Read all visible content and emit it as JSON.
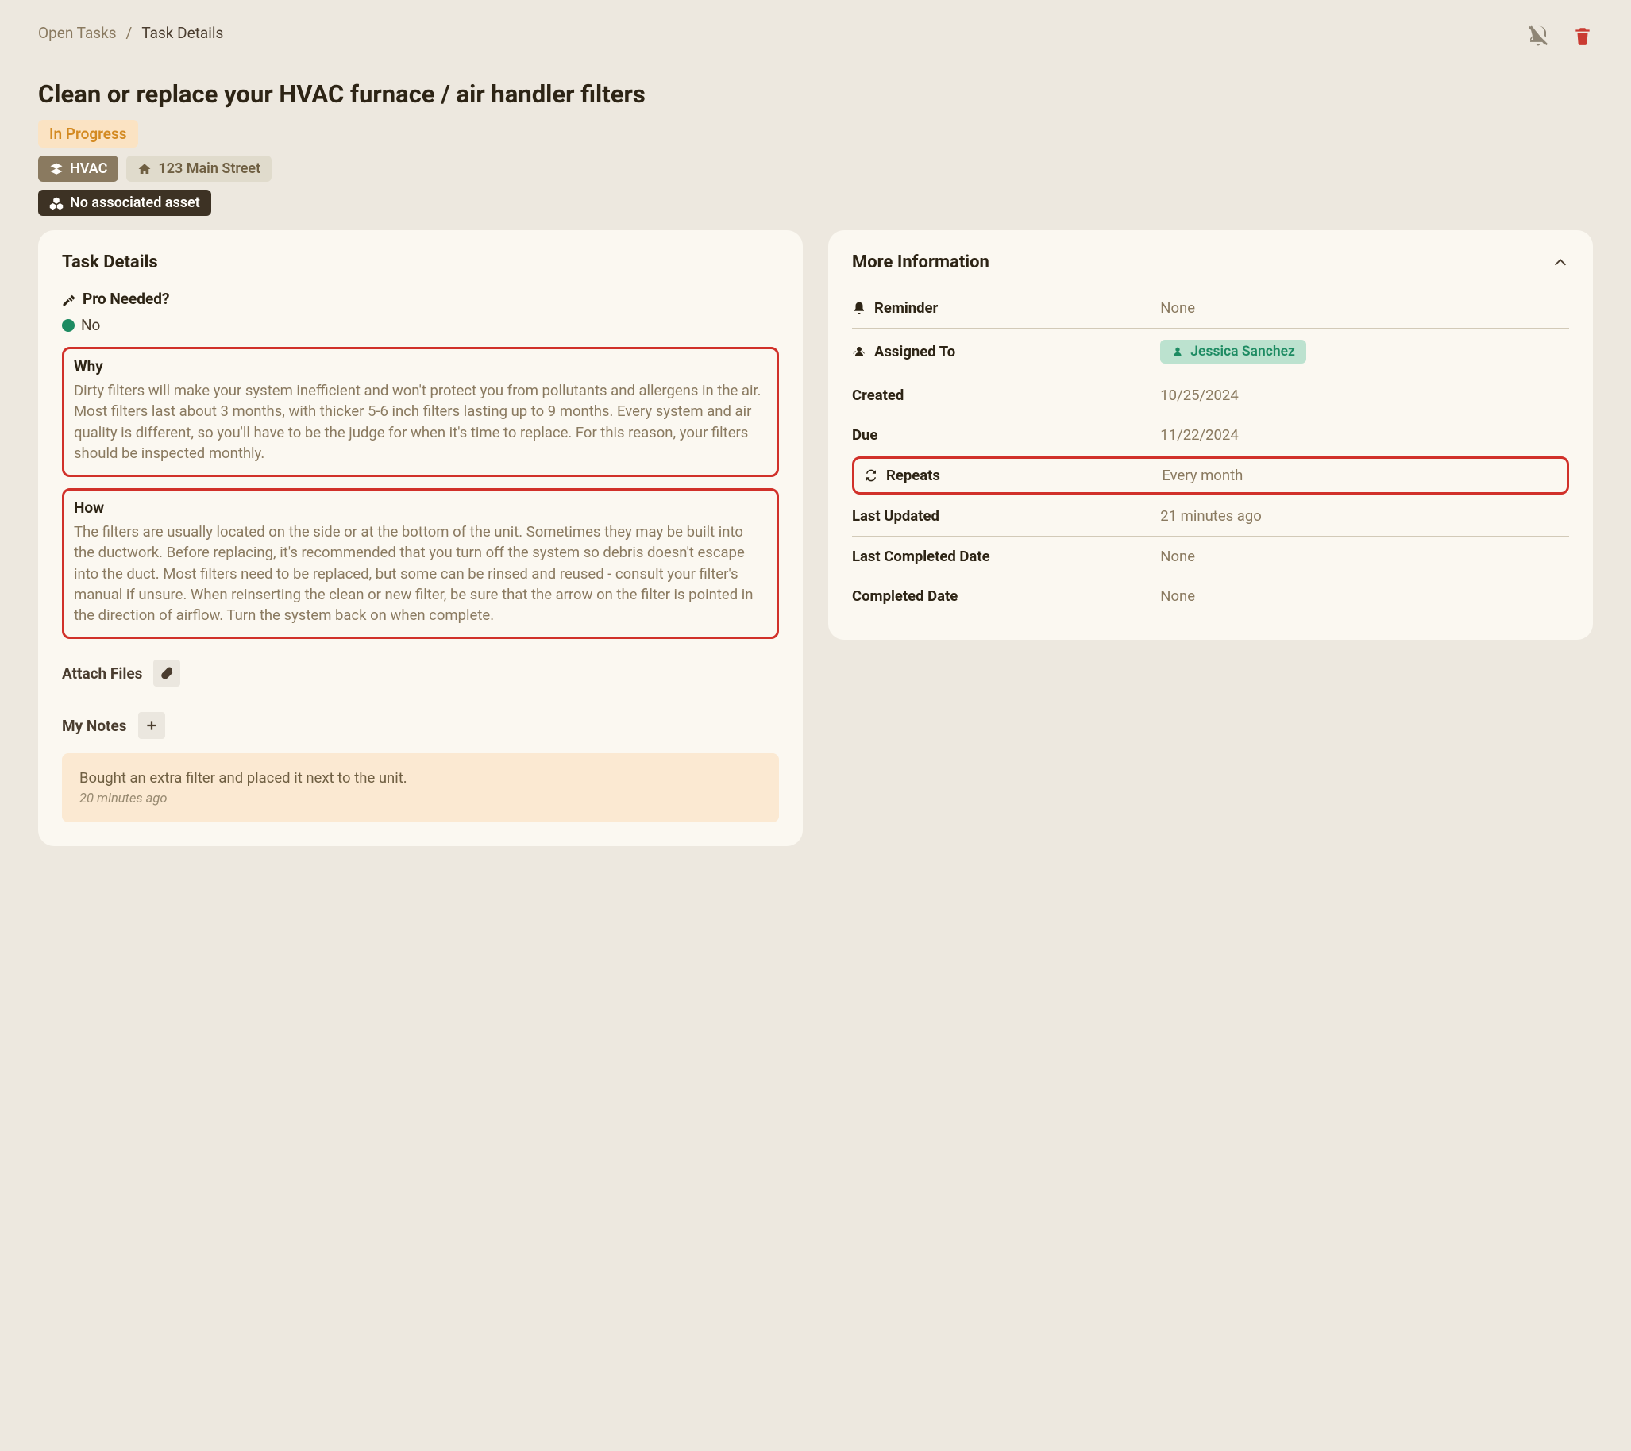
{
  "breadcrumb": {
    "root": "Open Tasks",
    "separator": "/",
    "current": "Task Details"
  },
  "title": "Clean or replace your HVAC furnace / air handler filters",
  "status_badge": "In Progress",
  "category_badge": "HVAC",
  "address_badge": "123 Main Street",
  "asset_badge": "No associated asset",
  "left_card": {
    "heading": "Task Details",
    "pro_heading": "Pro Needed?",
    "pro_answer": "No",
    "why_title": "Why",
    "why_body": "Dirty filters will make your system inefficient and won't protect you from pollutants and allergens in the air. Most filters last about 3 months, with thicker 5-6 inch filters lasting up to 9 months. Every system and air quality is different, so you'll have to be the judge for when it's time to replace. For this reason, your filters should be inspected monthly.",
    "how_title": "How",
    "how_body": "The filters are usually located on the side or at the bottom of the unit. Sometimes they may be built into the ductwork. Before replacing, it's recommended that you turn off the system so debris doesn't escape into the duct. Most filters need to be replaced, but some can be rinsed and reused - consult your filter's manual if unsure. When reinserting the clean or new filter, be sure that the arrow on the filter is pointed in the direction of airflow. Turn the system back on when complete.",
    "attach_label": "Attach Files",
    "notes_label": "My Notes",
    "note_text": "Bought an extra filter and placed it next to the unit.",
    "note_meta": "20 minutes ago"
  },
  "right_card": {
    "heading": "More Information",
    "reminder_label": "Reminder",
    "reminder_value": "None",
    "assigned_label": "Assigned To",
    "assigned_value": "Jessica Sanchez",
    "created_label": "Created",
    "created_value": "10/25/2024",
    "due_label": "Due",
    "due_value": "11/22/2024",
    "repeats_label": "Repeats",
    "repeats_value": "Every month",
    "updated_label": "Last Updated",
    "updated_value": "21 minutes ago",
    "last_completed_label": "Last Completed Date",
    "last_completed_value": "None",
    "completed_label": "Completed Date",
    "completed_value": "None"
  }
}
